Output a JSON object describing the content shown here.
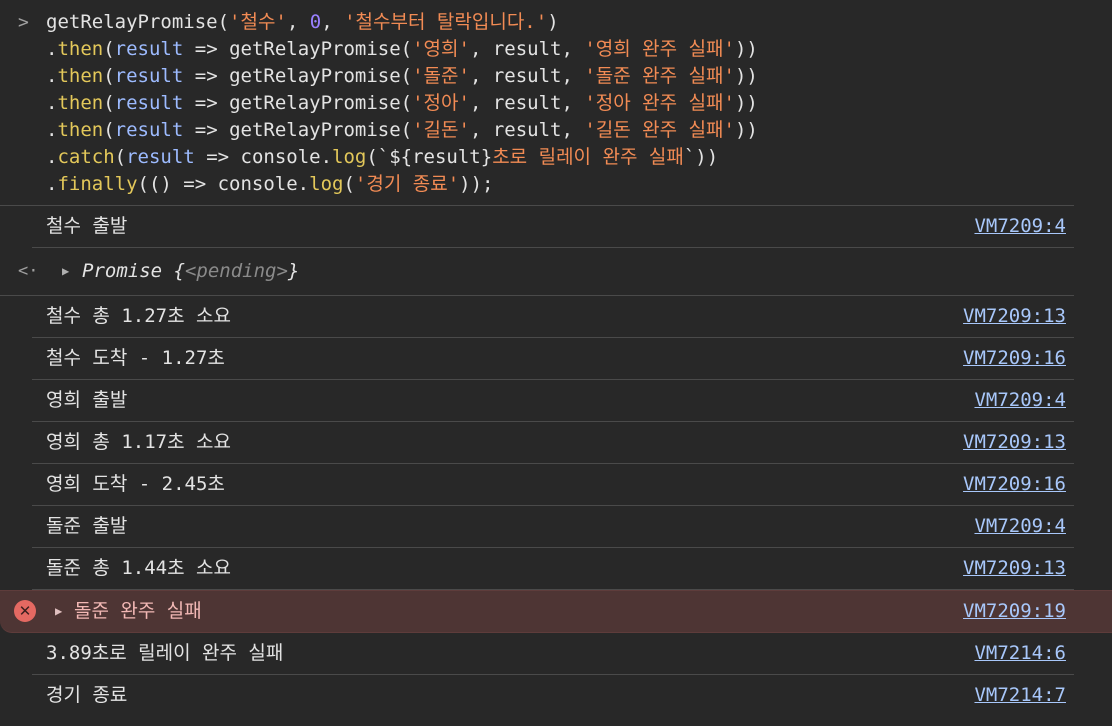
{
  "input": {
    "prompt_icon": "chevron-right-icon",
    "lines": [
      [
        {
          "t": "plain",
          "v": "getRelayPromise("
        },
        {
          "t": "str",
          "v": "'철수'"
        },
        {
          "t": "plain",
          "v": ", "
        },
        {
          "t": "num",
          "v": "0"
        },
        {
          "t": "plain",
          "v": ", "
        },
        {
          "t": "str",
          "v": "'철수부터 탈락입니다.'"
        },
        {
          "t": "plain",
          "v": ")"
        }
      ],
      [
        {
          "t": "plain",
          "v": "."
        },
        {
          "t": "kw",
          "v": "then"
        },
        {
          "t": "plain",
          "v": "("
        },
        {
          "t": "prop",
          "v": "result"
        },
        {
          "t": "plain",
          "v": " => getRelayPromise("
        },
        {
          "t": "str",
          "v": "'영희'"
        },
        {
          "t": "plain",
          "v": ", result, "
        },
        {
          "t": "str",
          "v": "'영희 완주 실패'"
        },
        {
          "t": "plain",
          "v": "))"
        }
      ],
      [
        {
          "t": "plain",
          "v": "."
        },
        {
          "t": "kw",
          "v": "then"
        },
        {
          "t": "plain",
          "v": "("
        },
        {
          "t": "prop",
          "v": "result"
        },
        {
          "t": "plain",
          "v": " => getRelayPromise("
        },
        {
          "t": "str",
          "v": "'돌준'"
        },
        {
          "t": "plain",
          "v": ", result, "
        },
        {
          "t": "str",
          "v": "'돌준 완주 실패'"
        },
        {
          "t": "plain",
          "v": "))"
        }
      ],
      [
        {
          "t": "plain",
          "v": "."
        },
        {
          "t": "kw",
          "v": "then"
        },
        {
          "t": "plain",
          "v": "("
        },
        {
          "t": "prop",
          "v": "result"
        },
        {
          "t": "plain",
          "v": " => getRelayPromise("
        },
        {
          "t": "str",
          "v": "'정아'"
        },
        {
          "t": "plain",
          "v": ", result, "
        },
        {
          "t": "str",
          "v": "'정아 완주 실패'"
        },
        {
          "t": "plain",
          "v": "))"
        }
      ],
      [
        {
          "t": "plain",
          "v": "."
        },
        {
          "t": "kw",
          "v": "then"
        },
        {
          "t": "plain",
          "v": "("
        },
        {
          "t": "prop",
          "v": "result"
        },
        {
          "t": "plain",
          "v": " => getRelayPromise("
        },
        {
          "t": "str",
          "v": "'길돈'"
        },
        {
          "t": "plain",
          "v": ", result, "
        },
        {
          "t": "str",
          "v": "'길돈 완주 실패'"
        },
        {
          "t": "plain",
          "v": "))"
        }
      ],
      [
        {
          "t": "plain",
          "v": "."
        },
        {
          "t": "kw",
          "v": "catch"
        },
        {
          "t": "plain",
          "v": "("
        },
        {
          "t": "prop",
          "v": "result"
        },
        {
          "t": "plain",
          "v": " => console."
        },
        {
          "t": "kw",
          "v": "log"
        },
        {
          "t": "plain",
          "v": "(`${result}"
        },
        {
          "t": "str",
          "v": "초로 릴레이 완주 실패"
        },
        {
          "t": "plain",
          "v": "`))"
        }
      ],
      [
        {
          "t": "plain",
          "v": "."
        },
        {
          "t": "kw",
          "v": "finally"
        },
        {
          "t": "plain",
          "v": "(() => console."
        },
        {
          "t": "kw",
          "v": "log"
        },
        {
          "t": "plain",
          "v": "("
        },
        {
          "t": "str",
          "v": "'경기 종료'"
        },
        {
          "t": "plain",
          "v": "));"
        }
      ]
    ]
  },
  "messages": [
    {
      "text": "철수 출발",
      "source": "VM7209:4"
    },
    {
      "kind": "result",
      "icon": "return-arrow-icon",
      "obj_name": "Promise",
      "obj_open": " {",
      "obj_state": "<pending>",
      "obj_close": "}"
    },
    {
      "text": "철수 총 1.27초 소요",
      "source": "VM7209:13"
    },
    {
      "text": "철수 도착 - 1.27초",
      "source": "VM7209:16"
    },
    {
      "text": "영희 출발",
      "source": "VM7209:4"
    },
    {
      "text": "영희 총 1.17초 소요",
      "source": "VM7209:13"
    },
    {
      "text": "영희 도착 - 2.45초",
      "source": "VM7209:16"
    },
    {
      "text": "돌준 출발",
      "source": "VM7209:4"
    },
    {
      "text": "돌준 총 1.44초 소요",
      "source": "VM7209:13"
    },
    {
      "kind": "error",
      "icon": "error-x-icon",
      "text": "돌준 완주 실패",
      "source": "VM7209:19"
    },
    {
      "text": "3.89초로 릴레이 완주 실패",
      "source": "VM7214:6"
    },
    {
      "text": "경기 종료",
      "source": "VM7214:7"
    }
  ],
  "colors": {
    "background": "#282828",
    "string": "#f28b54",
    "number": "#9980ff",
    "keyword": "#e3c85a",
    "param": "#9dbbff",
    "link": "#a8c7fa",
    "error_bg": "#4e3534",
    "error_text": "#f2b8b5",
    "error_icon": "#e46962"
  }
}
